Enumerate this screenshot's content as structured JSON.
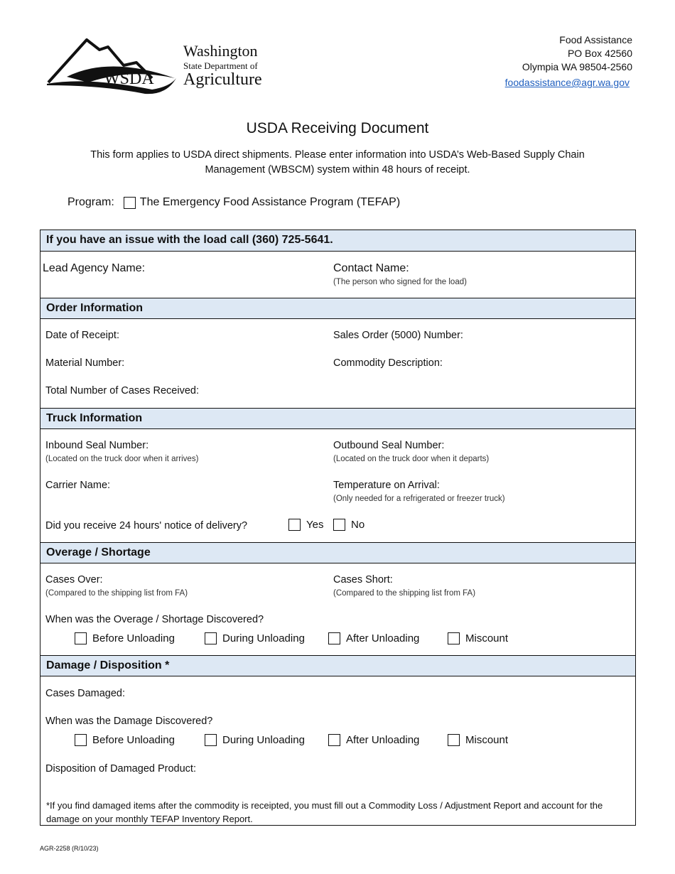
{
  "header": {
    "logo": {
      "mark": "WSDA",
      "org_line1": "Washington",
      "org_line2": "State Department of",
      "org_line3": "Agriculture"
    },
    "address": [
      "Food Assistance",
      "PO Box 42560",
      "Olympia WA  98504-2560"
    ],
    "email": "foodassistance@agr.wa.gov",
    "link_color": "#1f5fbf"
  },
  "document": {
    "title": "USDA Receiving Document",
    "intro": "This form applies to USDA direct shipments. Please enter information into USDA’s Web-Based Supply Chain Management (WBSCM) system within 48 hours of receipt.",
    "program_label": "Program:",
    "program_option": "The Emergency Food Assistance Program (TEFAP)",
    "program_checked": false,
    "band_color": "#dde8f4"
  },
  "sections": {
    "contact": {
      "header": "If you have an issue with the load call (360) 725-5641.",
      "lead_agency": "Lead Agency Name:",
      "contact_name": "Contact Name:",
      "contact_hint": "(The person who signed for the load)"
    },
    "order": {
      "header": "Order Information",
      "date_of_receipt": "Date of Receipt:",
      "sales_order": "Sales Order (5000) Number:",
      "material_number": "Material Number:",
      "commodity_description": "Commodity Description:",
      "total_cases": "Total Number of Cases Received:"
    },
    "truck": {
      "header": "Truck Information",
      "inbound_seal": "Inbound Seal Number:",
      "inbound_hint": "(Located on the truck door when it arrives)",
      "outbound_seal": "Outbound Seal Number:",
      "outbound_hint": "(Located on the truck door when it departs)",
      "carrier_name": "Carrier Name:",
      "temperature": "Temperature on Arrival:",
      "temperature_hint": "(Only needed for a refrigerated or freezer truck)",
      "notice_question": "Did you receive 24 hours' notice of delivery?",
      "yes": "Yes",
      "no": "No"
    },
    "overage": {
      "header": "Overage / Shortage",
      "cases_over": "Cases Over:",
      "cases_over_hint": "(Compared to the shipping list from FA)",
      "cases_short": "Cases Short:",
      "cases_short_hint": "(Compared to the shipping list from FA)",
      "question": "When was the Overage / Shortage Discovered?",
      "options": [
        "Before Unloading",
        "During Unloading",
        "After Unloading",
        "Miscount"
      ]
    },
    "damage": {
      "header": "Damage / Disposition *",
      "cases_damaged": "Cases Damaged:",
      "question": "When was the Damage Discovered?",
      "options": [
        "Before Unloading",
        "During Unloading",
        "After Unloading",
        "Miscount"
      ],
      "disposition": "Disposition of Damaged Product:",
      "footnote": "*If you find damaged items after the commodity is receipted, you must fill out a Commodity Loss / Adjustment Report and account for the damage on your monthly TEFAP Inventory Report."
    }
  },
  "footer": {
    "form_code": "AGR-2258 (R/10/23)"
  }
}
